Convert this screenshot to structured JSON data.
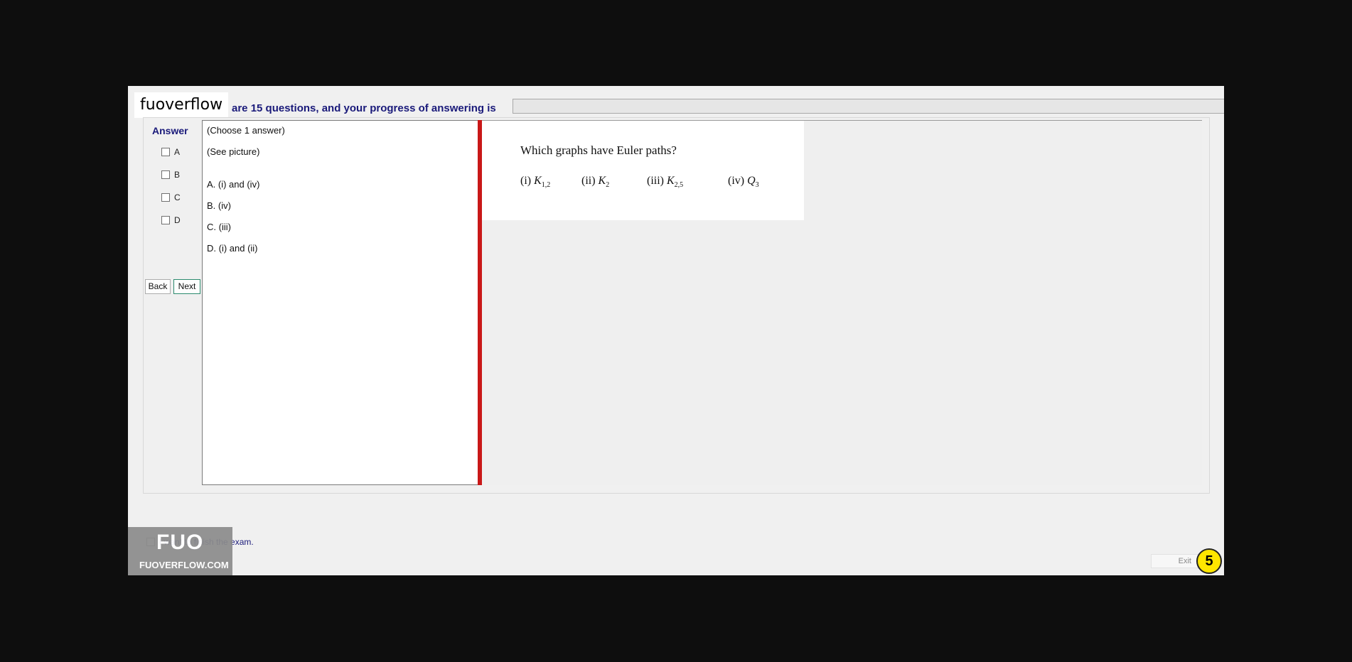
{
  "watermark": {
    "logo_text": "fuoverflow",
    "mark": "FUO",
    "url": "FUOVERFLOW.COM"
  },
  "header": {
    "progress_text": "are 15 questions, and your progress of answering is"
  },
  "answer_panel": {
    "title": "Answer",
    "options": [
      "A",
      "B",
      "C",
      "D"
    ],
    "back_label": "Back",
    "next_label": "Next"
  },
  "question_text": {
    "instruction": "(Choose 1 answer)",
    "hint": "(See picture)",
    "choices": [
      "A.  (i) and (iv)",
      "B.  (iv)",
      "C.  (iii)",
      "D.  (i) and (ii)"
    ]
  },
  "question_image": {
    "title": "Which graphs have Euler paths?",
    "items": [
      {
        "num": "(i)",
        "letter": "K",
        "sub": "1,2"
      },
      {
        "num": "(ii)",
        "letter": "K",
        "sub": "2"
      },
      {
        "num": "(iii)",
        "letter": "K",
        "sub": "2,5"
      },
      {
        "num": "(iv)",
        "letter": "Q",
        "sub": "3"
      }
    ]
  },
  "footer": {
    "finish_text": "I want to finish the exam.",
    "exit_label": "Exit",
    "page_number": "5"
  },
  "colors": {
    "accent_text": "#1a1a7a",
    "divider": "#c91818",
    "badge": "#ffe600"
  }
}
